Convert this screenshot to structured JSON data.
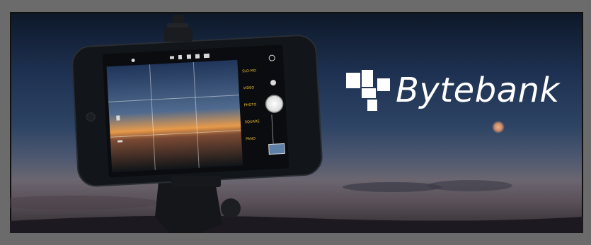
{
  "brand": {
    "name": "Bytebank",
    "text_color": "#ffffff"
  },
  "scene": {
    "sky_top": "#0d1828",
    "sky_horizon": "#6b6670",
    "moon_color": "#e8a070",
    "phone_body": "#111418"
  },
  "camera_app": {
    "mode_labels": [
      "SLO-MO",
      "VIDEO",
      "PHOTO",
      "SQUARE",
      "PANO"
    ]
  }
}
